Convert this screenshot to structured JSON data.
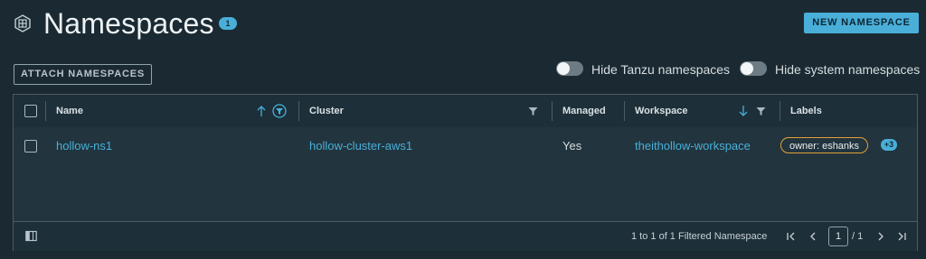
{
  "header": {
    "title": "Namespaces",
    "count": "1",
    "new_button": "NEW NAMESPACE"
  },
  "toolbar": {
    "attach_button": "ATTACH NAMESPACES",
    "toggle_tanzu": {
      "label": "Hide Tanzu namespaces",
      "on": false
    },
    "toggle_system": {
      "label": "Hide system namespaces",
      "on": false
    }
  },
  "grid": {
    "columns": [
      {
        "label": "Name",
        "sort": "ascending",
        "filter_active": true
      },
      {
        "label": "Cluster",
        "filter": true
      },
      {
        "label": "Managed"
      },
      {
        "label": "Workspace",
        "sort": "descending",
        "filter": true
      },
      {
        "label": "Labels"
      }
    ],
    "rows": [
      {
        "name": "hollow-ns1",
        "cluster": "hollow-cluster-aws1",
        "managed": "Yes",
        "workspace": "theithollow-workspace",
        "label": "owner: eshanks",
        "extra_labels": "+3"
      }
    ],
    "footer": {
      "summary": "1 to 1 of 1 Filtered Namespace",
      "current_page": "1",
      "total_pages": "/ 1"
    }
  },
  "colors": {
    "background": "#1b2a32",
    "accent": "#49afd9",
    "label_border": "#e6a03a"
  },
  "icons": [
    "namespace-icon",
    "sort-up-icon",
    "filter-icon",
    "sort-down-icon",
    "column-toggle-icon",
    "first-page-icon",
    "prev-page-icon",
    "next-page-icon",
    "last-page-icon"
  ]
}
